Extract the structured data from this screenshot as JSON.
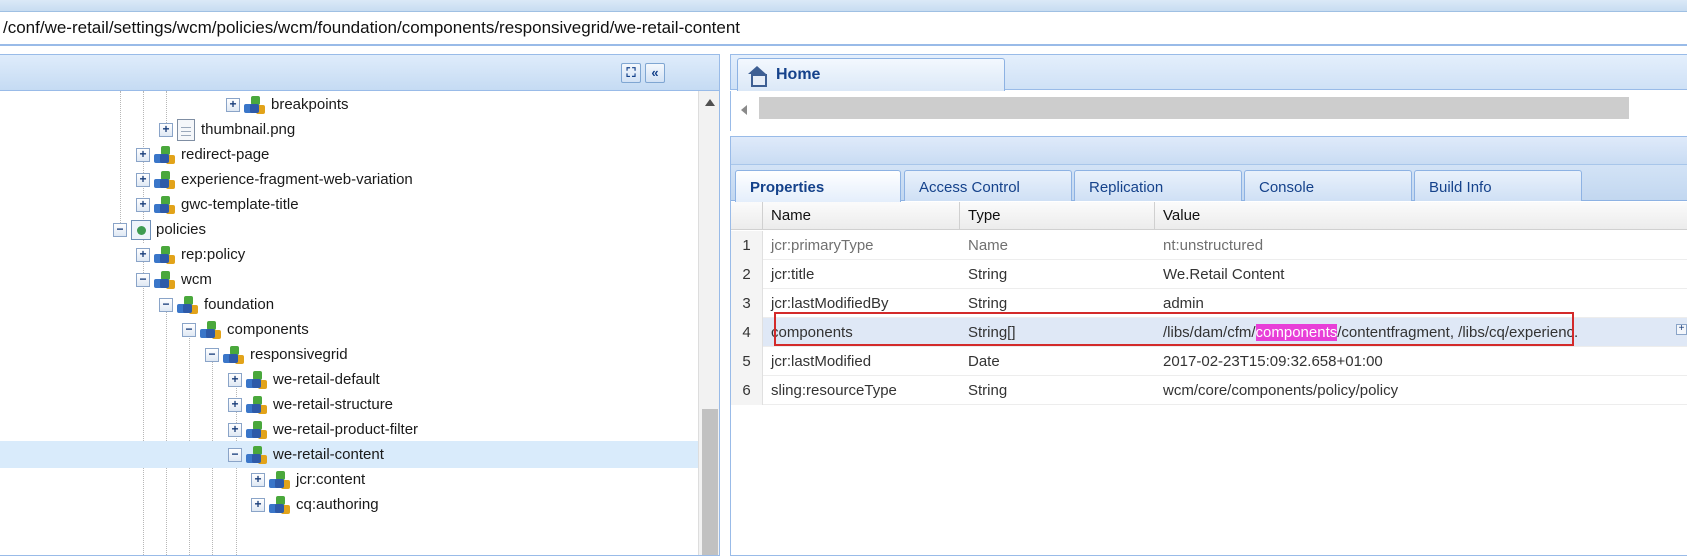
{
  "path_bar": {
    "path": "/conf/we-retail/settings/wcm/policies/wcm/foundation/components/responsivegrid/we-retail-content"
  },
  "left_panel": {
    "header_buttons": {
      "find_glyph": "⛶",
      "collapse_glyph": "«"
    },
    "tree": [
      {
        "label": "breakpoints",
        "toggle": "+",
        "icon": "component-icon"
      },
      {
        "label": "thumbnail.png",
        "toggle": "+",
        "icon": "file-icon"
      },
      {
        "label": "redirect-page",
        "toggle": "+",
        "icon": "component-icon"
      },
      {
        "label": "experience-fragment-web-variation",
        "toggle": "+",
        "icon": "component-icon"
      },
      {
        "label": "gwc-template-title",
        "toggle": "+",
        "icon": "component-icon"
      },
      {
        "label": "policies",
        "toggle": "−",
        "icon": "policy-icon"
      },
      {
        "label": "rep:policy",
        "toggle": "+",
        "icon": "component-icon"
      },
      {
        "label": "wcm",
        "toggle": "−",
        "icon": "component-icon"
      },
      {
        "label": "foundation",
        "toggle": "−",
        "icon": "component-icon"
      },
      {
        "label": "components",
        "toggle": "−",
        "icon": "component-icon"
      },
      {
        "label": "responsivegrid",
        "toggle": "−",
        "icon": "component-icon"
      },
      {
        "label": "we-retail-default",
        "toggle": "+",
        "icon": "component-icon"
      },
      {
        "label": "we-retail-structure",
        "toggle": "+",
        "icon": "component-icon"
      },
      {
        "label": "we-retail-product-filter",
        "toggle": "+",
        "icon": "component-icon"
      },
      {
        "label": "we-retail-content",
        "toggle": "−",
        "icon": "component-icon"
      },
      {
        "label": "jcr:content",
        "toggle": "+",
        "icon": "component-icon"
      },
      {
        "label": "cq:authoring",
        "toggle": "+",
        "icon": "component-icon"
      }
    ]
  },
  "right_panel": {
    "home_tab": {
      "label": "Home",
      "icon": "home-icon"
    },
    "tabs": [
      {
        "label": "Properties",
        "active": true
      },
      {
        "label": "Access Control",
        "active": false
      },
      {
        "label": "Replication",
        "active": false
      },
      {
        "label": "Console",
        "active": false
      },
      {
        "label": "Build Info",
        "active": false
      }
    ],
    "grid": {
      "columns": {
        "name": "Name",
        "type": "Type",
        "value": "Value"
      },
      "rows": [
        {
          "num": "1",
          "name": "jcr:primaryType",
          "type": "Name",
          "value": "nt:unstructured"
        },
        {
          "num": "2",
          "name": "jcr:title",
          "type": "String",
          "value": "We.Retail Content"
        },
        {
          "num": "3",
          "name": "jcr:lastModifiedBy",
          "type": "String",
          "value": "admin"
        },
        {
          "num": "4",
          "name": "components",
          "type": "String[]",
          "value_prefix": "/libs/dam/cfm/",
          "value_highlight": "components",
          "value_suffix": "/contentfragment, /libs/cq/experienc..."
        },
        {
          "num": "5",
          "name": "jcr:lastModified",
          "type": "Date",
          "value": "2017-02-23T15:09:32.658+01:00"
        },
        {
          "num": "6",
          "name": "sling:resourceType",
          "type": "String",
          "value": "wcm/core/components/policy/policy"
        }
      ]
    },
    "row_expand_glyph": "+"
  },
  "colors": {
    "accent": "#15428b",
    "highlight": "#e83fd8",
    "annotation_red": "#d32a2a",
    "selection": "#d9ebfb"
  }
}
